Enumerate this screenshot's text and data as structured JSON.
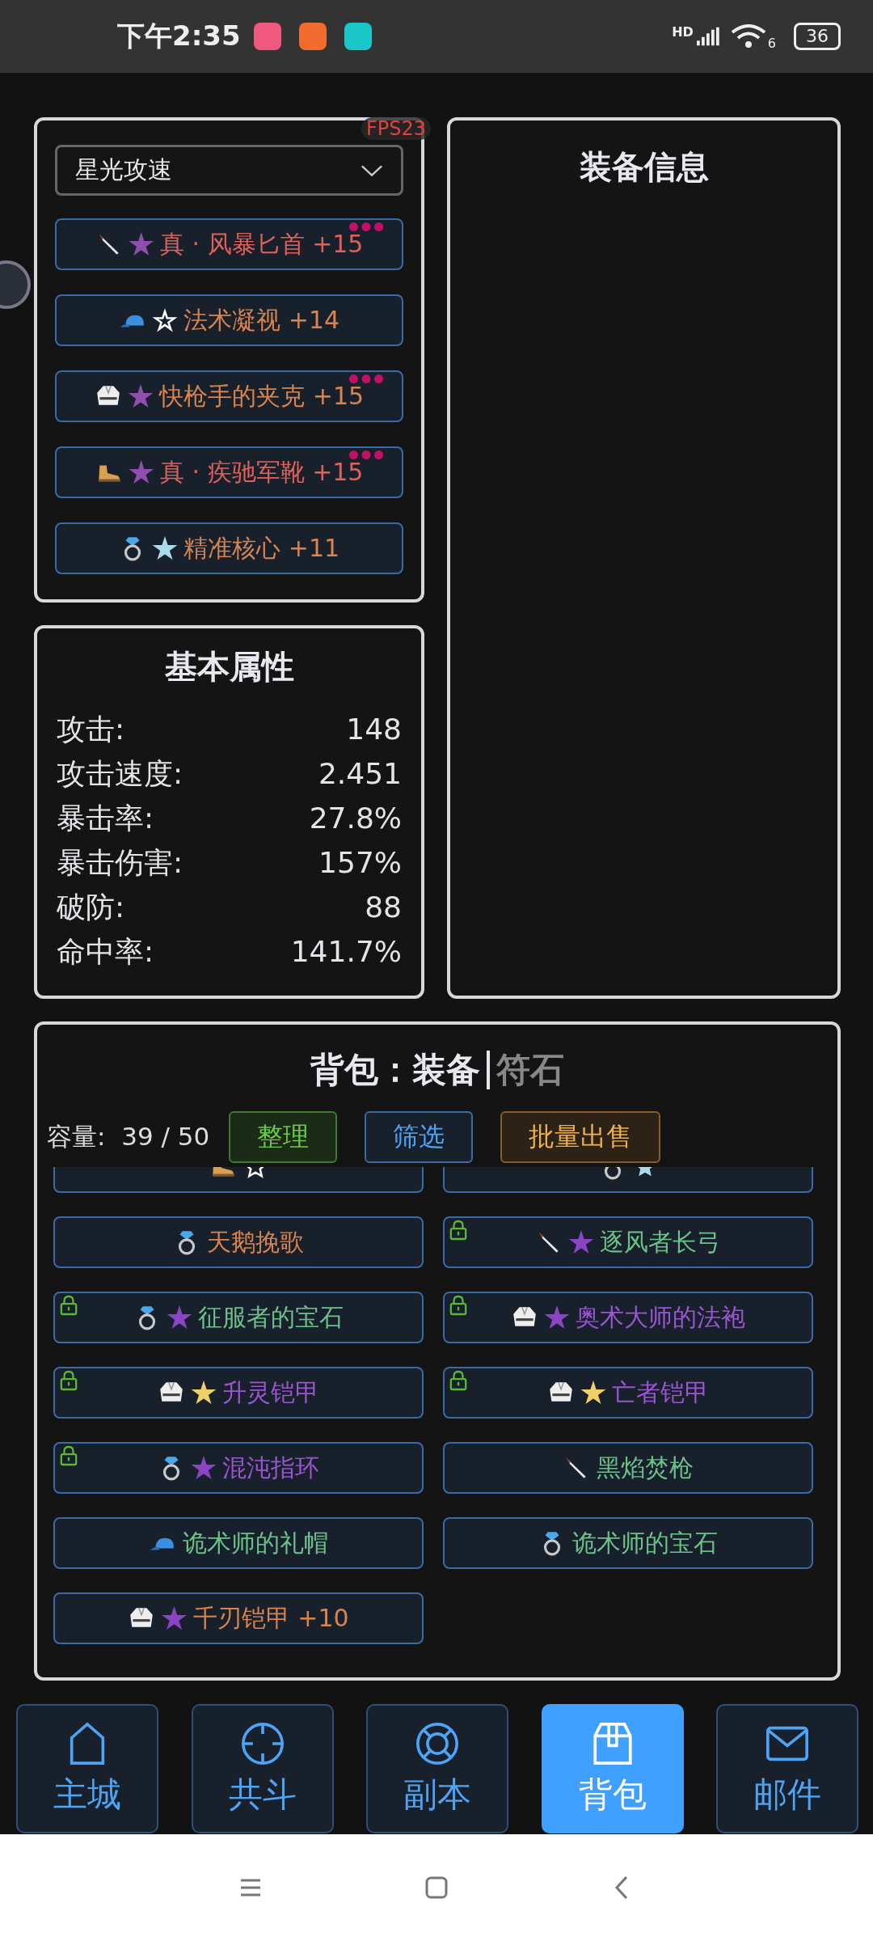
{
  "status_bar": {
    "time": "下午2:35",
    "network": "HD",
    "wifi": "6",
    "battery": "36"
  },
  "fps": "FPS23",
  "equipment_panel": {
    "dropdown": {
      "value": "星光攻速"
    },
    "items": [
      {
        "kind": "knife",
        "star": {
          "glyph": "★",
          "color": "#8e4fae"
        },
        "name": "真 · 风暴匕首 +15",
        "color": "#e0605a",
        "dots": true
      },
      {
        "kind": "cap",
        "star": {
          "glyph": "☆",
          "color": "#ffffff"
        },
        "name": "法术凝视 +14",
        "color": "#d9834f",
        "dots": false
      },
      {
        "kind": "robe",
        "star": {
          "glyph": "★",
          "color": "#8e4fae"
        },
        "name": "快枪手的夹克 +15",
        "color": "#d9834f",
        "dots": true
      },
      {
        "kind": "boot",
        "star": {
          "glyph": "★",
          "color": "#8e4fae"
        },
        "name": "真 · 疾驰军靴 +15",
        "color": "#e0605a",
        "dots": true
      },
      {
        "kind": "ring",
        "star": {
          "glyph": "★",
          "color": "#a9dbe8"
        },
        "name": "精准核心 +11",
        "color": "#d9834f",
        "dots": false
      }
    ]
  },
  "info_panel": {
    "title": "装备信息"
  },
  "stats_panel": {
    "title": "基本属性",
    "rows": [
      {
        "label": "攻击:",
        "value": "148"
      },
      {
        "label": "攻击速度:",
        "value": "2.451"
      },
      {
        "label": "暴击率:",
        "value": "27.8%"
      },
      {
        "label": "暴击伤害:",
        "value": "157%"
      },
      {
        "label": "破防:",
        "value": "88"
      },
      {
        "label": "命中率:",
        "value": "141.7%"
      }
    ]
  },
  "bag": {
    "title": "背包：",
    "tabs": [
      {
        "label": "装备",
        "selected": true
      },
      {
        "label": "符石",
        "selected": false
      }
    ],
    "capacity": "容量:  39 / 50",
    "buttons": [
      {
        "label": "整理",
        "kind": "green"
      },
      {
        "label": "筛选",
        "kind": "blue"
      },
      {
        "label": "批量出售",
        "kind": "orange"
      }
    ],
    "items": [
      {
        "kind": "boot",
        "star": {
          "kind": "outline",
          "color": "#ffffff"
        },
        "locked": false
      },
      {
        "kind": "ring",
        "star": {
          "kind": "filled",
          "color": "#a9dbe8"
        },
        "locked": false
      },
      {
        "kind": "ring",
        "name": "天鹅挽歌",
        "color": "#d9834f",
        "locked": false
      },
      {
        "kind": "knife",
        "star": {
          "glyph": "★",
          "color": "#8b45c2"
        },
        "name": "逐风者长弓",
        "color": "#6cc08a",
        "locked": true
      },
      {
        "kind": "ring",
        "star": {
          "glyph": "★",
          "color": "#8b45c2"
        },
        "name": "征服者的宝石",
        "color": "#6cc08a",
        "locked": true
      },
      {
        "kind": "robe",
        "star": {
          "glyph": "★",
          "color": "#8b45c2"
        },
        "name": "奥术大师的法袍",
        "color": "#9a55d0",
        "locked": true
      },
      {
        "kind": "robe",
        "star": {
          "glyph": "★",
          "color": "#f0cf6a"
        },
        "name": "升灵铠甲",
        "color": "#9a55d0",
        "locked": true
      },
      {
        "kind": "robe",
        "star": {
          "glyph": "★",
          "color": "#f0cf6a"
        },
        "name": "亡者铠甲",
        "color": "#9a55d0",
        "locked": true
      },
      {
        "kind": "ring",
        "star": {
          "glyph": "★",
          "color": "#8b45c2"
        },
        "name": "混沌指环",
        "color": "#9a55d0",
        "locked": true
      },
      {
        "kind": "knife",
        "name": "黑焰焚枪",
        "color": "#6cc08a",
        "locked": false
      },
      {
        "kind": "cap",
        "name": "诡术师的礼帽",
        "color": "#6cc08a",
        "locked": false
      },
      {
        "kind": "ring",
        "name": "诡术师的宝石",
        "color": "#6cc08a",
        "locked": false
      },
      {
        "kind": "robe",
        "star": {
          "glyph": "★",
          "color": "#8b45c2"
        },
        "name": "千刃铠甲 +10",
        "color": "#d9834f",
        "locked": false
      }
    ]
  },
  "nav": [
    {
      "label": "主城",
      "kind": "home",
      "selected": false
    },
    {
      "label": "共斗",
      "kind": "crosshair",
      "selected": false
    },
    {
      "label": "副本",
      "kind": "lifebuoy",
      "selected": false
    },
    {
      "label": "背包",
      "kind": "box",
      "selected": true
    },
    {
      "label": "邮件",
      "kind": "mail",
      "selected": false
    }
  ],
  "system_nav": [
    {
      "kind": "menu"
    },
    {
      "kind": "home"
    },
    {
      "kind": "back"
    }
  ]
}
